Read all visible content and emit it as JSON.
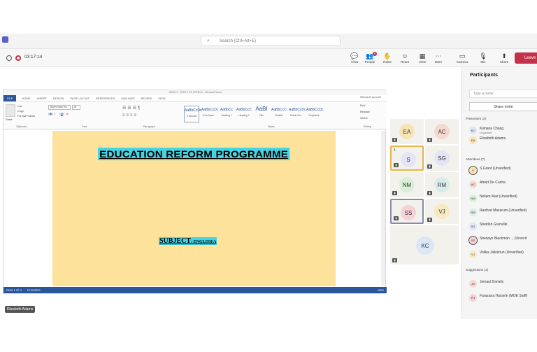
{
  "search": {
    "placeholder": "Search (Ctrl+Alt+E)"
  },
  "meeting": {
    "timer": "03:17:14",
    "leave_label": "Leave"
  },
  "toolbar": [
    {
      "label": "Chat",
      "icon": "chat-icon",
      "glyph": "💬"
    },
    {
      "label": "People",
      "icon": "people-icon",
      "glyph": "👥",
      "badge": "9"
    },
    {
      "label": "Raise",
      "icon": "raise-hand-icon",
      "glyph": "✋"
    },
    {
      "label": "React",
      "icon": "react-icon",
      "glyph": "☺"
    },
    {
      "label": "View",
      "icon": "view-icon",
      "glyph": "▦"
    },
    {
      "label": "More",
      "icon": "more-icon",
      "glyph": "⋯"
    },
    {
      "label": "Camera",
      "icon": "camera-icon",
      "glyph": "▭"
    },
    {
      "label": "Mic",
      "icon": "mic-icon",
      "glyph": "🎙"
    },
    {
      "label": "Share",
      "icon": "share-icon",
      "glyph": "⬆"
    }
  ],
  "word": {
    "window_title": "WEEK 3 - PARTS OF SPEECH - Microsoft Word",
    "account": "Microsoft account",
    "tabs": [
      "FILE",
      "HOME",
      "INSERT",
      "DESIGN",
      "PAGE LAYOUT",
      "REFERENCES",
      "MAILINGS",
      "REVIEW",
      "VIEW"
    ],
    "font_name": "Times New Ro",
    "font_size": "28",
    "clipboard": {
      "paste": "Paste",
      "cut": "Cut",
      "copy": "Copy",
      "format_painter": "Format Painter",
      "group": "Clipboard"
    },
    "groups": {
      "font": "Font",
      "paragraph": "Paragraph",
      "styles": "Styles",
      "editing": "Editing"
    },
    "styles": [
      {
        "preview": "AaBbCcDc",
        "name": "¶ Normal"
      },
      {
        "preview": "AaBbCcDc",
        "name": "¶ No Spac..."
      },
      {
        "preview": "AaBbCc",
        "name": "Heading 1"
      },
      {
        "preview": "AaBbCcC",
        "name": "Heading 2"
      },
      {
        "preview": "AaBI",
        "name": "Title"
      },
      {
        "preview": "AaBbCcC",
        "name": "Subtitle"
      },
      {
        "preview": "AaBbCcDc",
        "name": "Subtle Em..."
      },
      {
        "preview": "AaBbCcDc",
        "name": "Emphasis"
      }
    ],
    "editing": {
      "find": "Find",
      "replace": "Replace",
      "select": "Select"
    },
    "doc_title": "EDUCATION REFORM PROGRAMME",
    "doc_subject": "SUBJECT",
    "doc_subject_rest": ": ENGLISH A",
    "status": {
      "page": "PAGE 1 OF 4",
      "words": "22 WORDS",
      "zoom": "118%"
    }
  },
  "tiles": [
    {
      "initials": "EA",
      "color": "#f7e3b5"
    },
    {
      "initials": "AC",
      "color": "#f4d9d0"
    },
    {
      "initials": "S",
      "color": "#e4e4f7",
      "highlight": true,
      "raised": "1"
    },
    {
      "initials": "SG",
      "color": "#e4e4f7"
    },
    {
      "initials": "NM",
      "color": "#d8efd8"
    },
    {
      "initials": "RM",
      "color": "#d8ece8"
    },
    {
      "initials": "SS",
      "color": "#f4d2d8",
      "outline": true
    },
    {
      "initials": "VJ",
      "color": "#f7e9c0"
    },
    {
      "initials": "KC",
      "color": "#dce7f5"
    }
  ],
  "spotlight_name": "Elizabeth Adams",
  "panel": {
    "title": "Participants",
    "invite_placeholder": "Type a name",
    "share_invite": "Share invite",
    "presenters_label": "Presenters (2)",
    "attendees_label": "Attendees (7)",
    "suggestions_label": "Suggestions (2)",
    "presenters": [
      {
        "initials": "KC",
        "name": "Kishana Chang",
        "sub": "Organiser",
        "color": "#dce7f5"
      },
      {
        "initials": "EA",
        "name": "Elizabeth Adams",
        "sub": "",
        "color": "#f7e3b5"
      }
    ],
    "attendees": [
      {
        "initials": "S",
        "name": "S.Grant (Unverified)",
        "color": "#f7e3b5",
        "ring": true
      },
      {
        "initials": "AC",
        "name": "Afreid De Cunha",
        "color": "#f4d9d0"
      },
      {
        "initials": "NM",
        "name": "Neilam Maz (Unverified)",
        "color": "#d8efd8"
      },
      {
        "initials": "RM",
        "name": "Ranfred Mazarum (Unverified)",
        "color": "#d8ece8"
      },
      {
        "initials": "SG",
        "name": "Sheldon Granville",
        "color": "#e4e4f7"
      },
      {
        "initials": "SS",
        "name": "Sherwyn Blackman ... (Unverif",
        "color": "#f4d2d8",
        "ring": true
      },
      {
        "initials": "VJ",
        "name": "Volika Jaikishun (Unverified)",
        "color": "#f7e9c0"
      }
    ],
    "suggestions": [
      {
        "initials": "JD",
        "name": "Jemaul Daniels",
        "color": "#f4d9d0"
      },
      {
        "initials": "FH",
        "name": "Farazana Hussein (MOE Staff)",
        "color": "#f4d2d8"
      }
    ]
  }
}
